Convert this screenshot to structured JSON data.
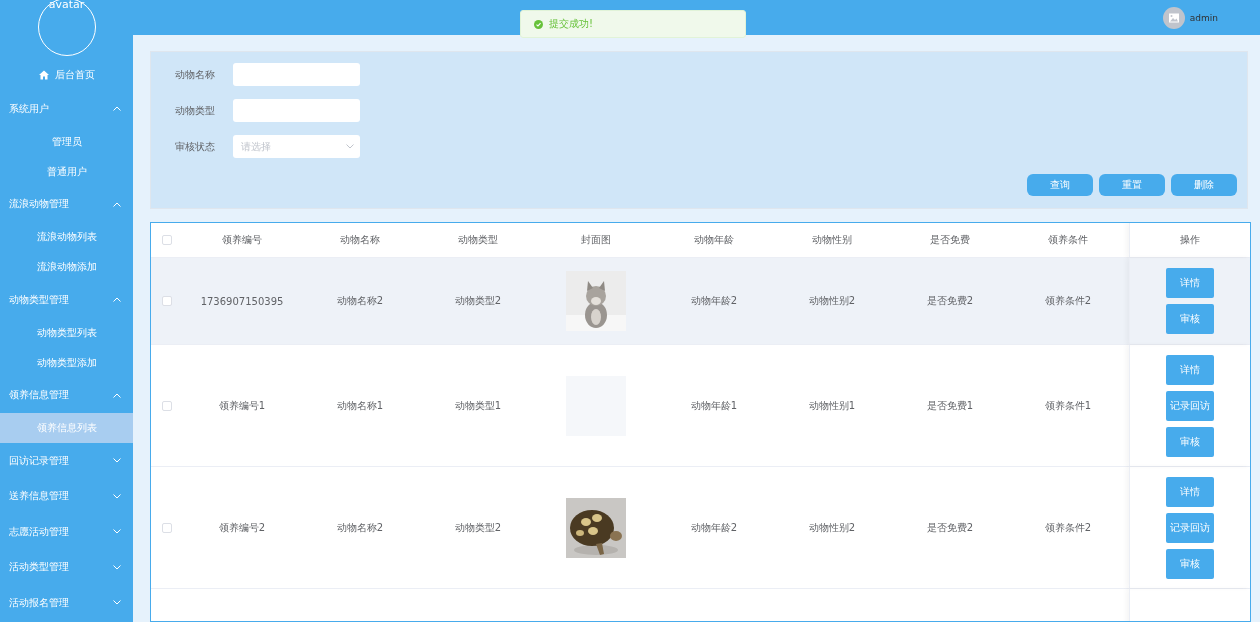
{
  "sidebar": {
    "avatar_text": "avatar",
    "home": "后台首页",
    "groups": [
      {
        "label": "系统用户",
        "expanded": true,
        "items": [
          {
            "label": "管理员",
            "selected": false
          },
          {
            "label": "普通用户",
            "selected": false
          }
        ]
      },
      {
        "label": "流浪动物管理",
        "expanded": true,
        "items": [
          {
            "label": "流浪动物列表",
            "selected": false
          },
          {
            "label": "流浪动物添加",
            "selected": false
          }
        ]
      },
      {
        "label": "动物类型管理",
        "expanded": true,
        "items": [
          {
            "label": "动物类型列表",
            "selected": false
          },
          {
            "label": "动物类型添加",
            "selected": false
          }
        ]
      },
      {
        "label": "领养信息管理",
        "expanded": true,
        "items": [
          {
            "label": "领养信息列表",
            "selected": true
          }
        ]
      },
      {
        "label": "回访记录管理",
        "expanded": false
      },
      {
        "label": "送养信息管理",
        "expanded": false
      },
      {
        "label": "志愿活动管理",
        "expanded": false
      },
      {
        "label": "活动类型管理",
        "expanded": false
      },
      {
        "label": "活动报名管理",
        "expanded": false
      }
    ]
  },
  "header": {
    "user": "admin"
  },
  "toast": {
    "message": "提交成功!"
  },
  "search": {
    "fields": [
      {
        "kind": "input",
        "label": "动物名称"
      },
      {
        "kind": "input",
        "label": "动物类型"
      },
      {
        "kind": "select",
        "label": "审核状态",
        "placeholder": "请选择"
      }
    ],
    "buttons": [
      "查询",
      "重置",
      "删除"
    ]
  },
  "table": {
    "all_checked": false,
    "columns": [
      "领养编号",
      "动物名称",
      "动物类型",
      "封面图",
      "动物年龄",
      "动物性别",
      "是否免费",
      "领养条件",
      "操作"
    ],
    "rows": [
      {
        "checked": false,
        "highlighted": true,
        "cells": [
          "1736907150395",
          "动物名称2",
          "动物类型2",
          {
            "kind": "cat"
          },
          "动物年龄2",
          "动物性别2",
          "是否免费2",
          "领养条件2"
        ],
        "actions": [
          "详情",
          "审核"
        ]
      },
      {
        "checked": false,
        "highlighted": false,
        "cells": [
          "领养编号1",
          "动物名称1",
          "动物类型1",
          {
            "kind": "empty"
          },
          "动物年龄1",
          "动物性别1",
          "是否免费1",
          "领养条件1"
        ],
        "actions": [
          "详情",
          "记录回访",
          "审核"
        ]
      },
      {
        "checked": false,
        "highlighted": false,
        "cells": [
          "领养编号2",
          "动物名称2",
          "动物类型2",
          {
            "kind": "tortoise"
          },
          "动物年龄2",
          "动物性别2",
          "是否免费2",
          "领养条件2"
        ],
        "actions": [
          "详情",
          "记录回访",
          "审核"
        ]
      }
    ]
  }
}
